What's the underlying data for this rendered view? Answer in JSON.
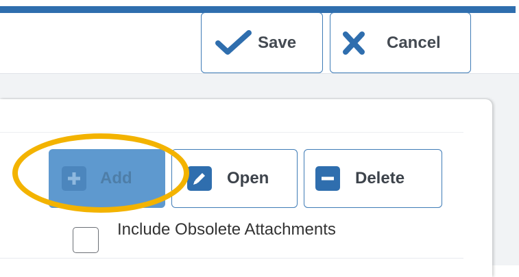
{
  "toolbar": {
    "save": {
      "label": "Save",
      "icon": "checkmark-icon"
    },
    "cancel": {
      "label": "Cancel",
      "icon": "x-icon"
    }
  },
  "actions": {
    "add": {
      "label": "Add",
      "icon": "plus-icon",
      "state": "active"
    },
    "open": {
      "label": "Open",
      "icon": "pencil-icon"
    },
    "delete": {
      "label": "Delete",
      "icon": "minus-icon"
    }
  },
  "options": {
    "include_obsolete": {
      "label": "Include Obsolete Attachments",
      "checked": false
    }
  },
  "highlight": {
    "target": "add",
    "color": "#f3b300"
  },
  "colors": {
    "accent": "#2f6eae",
    "button_border": "#3e7bb6",
    "add_button_active": "#5e99cf"
  }
}
